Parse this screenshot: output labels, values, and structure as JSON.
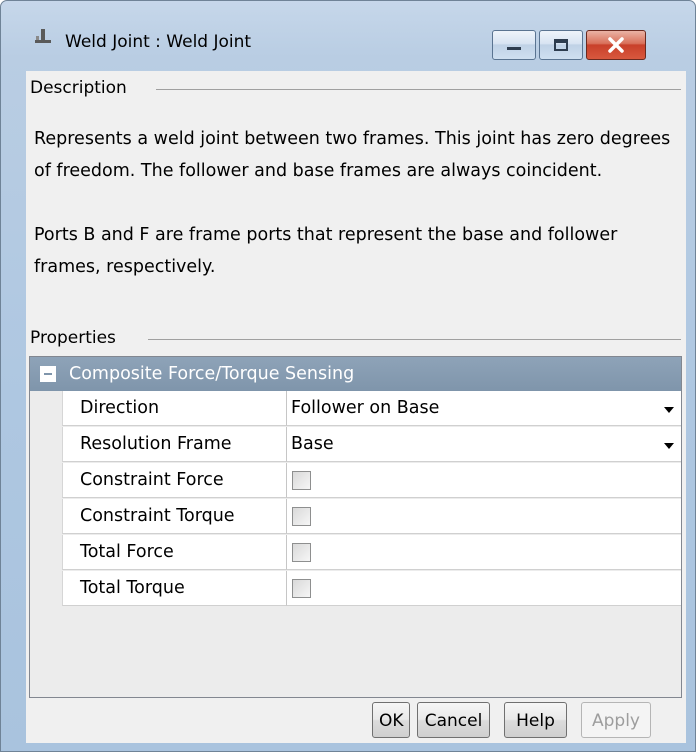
{
  "window": {
    "title": "Weld Joint : Weld Joint",
    "icon": "weld-joint-icon",
    "controls": {
      "minimize": "minimize-icon",
      "maximize": "maximize-icon",
      "close": "close-icon"
    }
  },
  "description": {
    "label": "Description",
    "paragraph1": "Represents a weld joint between two frames. This joint has zero degrees of freedom. The follower and base frames are always coincident.",
    "paragraph2": "Ports B and F are frame ports that represent the base and follower frames, respectively."
  },
  "properties": {
    "label": "Properties",
    "group": {
      "title": "Composite Force/Torque Sensing",
      "collapse_icon": "collapse-minus-icon",
      "rows": [
        {
          "name": "Direction",
          "type": "dropdown",
          "value": "Follower on Base"
        },
        {
          "name": "Resolution Frame",
          "type": "dropdown",
          "value": "Base"
        },
        {
          "name": "Constraint Force",
          "type": "checkbox",
          "checked": false
        },
        {
          "name": "Constraint Torque",
          "type": "checkbox",
          "checked": false
        },
        {
          "name": "Total Force",
          "type": "checkbox",
          "checked": false
        },
        {
          "name": "Total Torque",
          "type": "checkbox",
          "checked": false
        }
      ]
    }
  },
  "buttons": {
    "ok": "OK",
    "cancel": "Cancel",
    "help": "Help",
    "apply": "Apply",
    "apply_enabled": false
  },
  "colors": {
    "frame": "#b9cde3",
    "group_header": "#8599ae",
    "panel": "#f0f0f0"
  }
}
